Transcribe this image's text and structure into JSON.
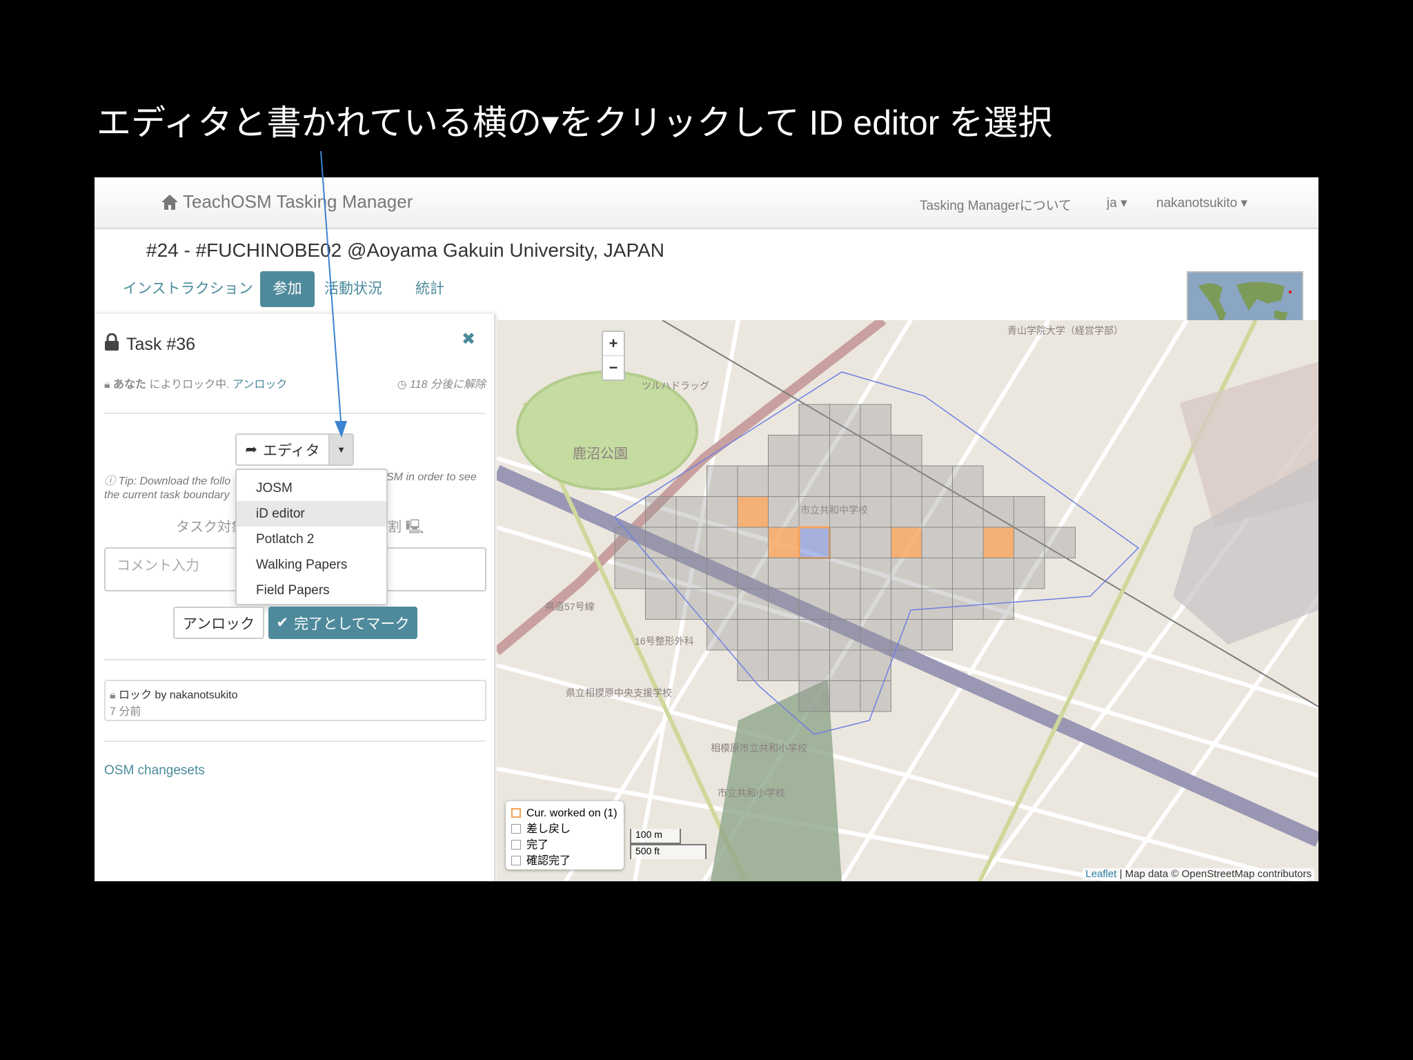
{
  "caption": "エディタと書かれている横の▾をクリックして ID editor を選択",
  "navbar": {
    "brand": "TeachOSM Tasking Manager",
    "about": "Tasking Managerについて",
    "lang": "ja",
    "user": "nakanotsukito"
  },
  "project_title": "#24 - #FUCHINOBE02 @Aoyama Gakuin University, JAPAN",
  "tabs": [
    {
      "label": "インストラクション"
    },
    {
      "label": "参加"
    },
    {
      "label": "活動状況"
    },
    {
      "label": "統計"
    }
  ],
  "task": {
    "title": "Task #36",
    "locked_by": "あなた",
    "locked_suffix": "によりロック中.",
    "unlock_link": "アンロック",
    "release": "118 分後に解除",
    "editor_button": "エディタ",
    "editors": [
      "JOSM",
      "iD editor",
      "Potlatch 2",
      "Walking Papers",
      "Field Papers"
    ],
    "tip_line1_a": "Tip: Download the follo",
    "tip_line1_b": "SM in order to see",
    "tip_line2": "the current task boundary",
    "task_target_a": "タスク対象",
    "task_target_b": "割",
    "comment_placeholder": "コメント入力",
    "unlock_button": "アンロック",
    "done_button": "完了としてマーク",
    "history_text": "ロック by nakanotsukito",
    "history_time": "7 分前",
    "changesets": "OSM changesets"
  },
  "map": {
    "zoom_in": "+",
    "zoom_out": "−",
    "legend": [
      "Cur. worked on (1)",
      "差し戻し",
      "完了",
      "確認完了"
    ],
    "scale_m": "100 m",
    "scale_ft": "500 ft",
    "attribution_link": "Leaflet",
    "attribution_text": " | Map data © OpenStreetMap contributors",
    "labels": [
      "鹿沼公園",
      "青山学院大学（経営学部）",
      "市立共和中学校",
      "16号整形外科",
      "県立相模原中央支援学校",
      "相模原市立共和小学校",
      "市立共和小学校",
      "県道57号線",
      "ツルハドラッグ"
    ]
  }
}
